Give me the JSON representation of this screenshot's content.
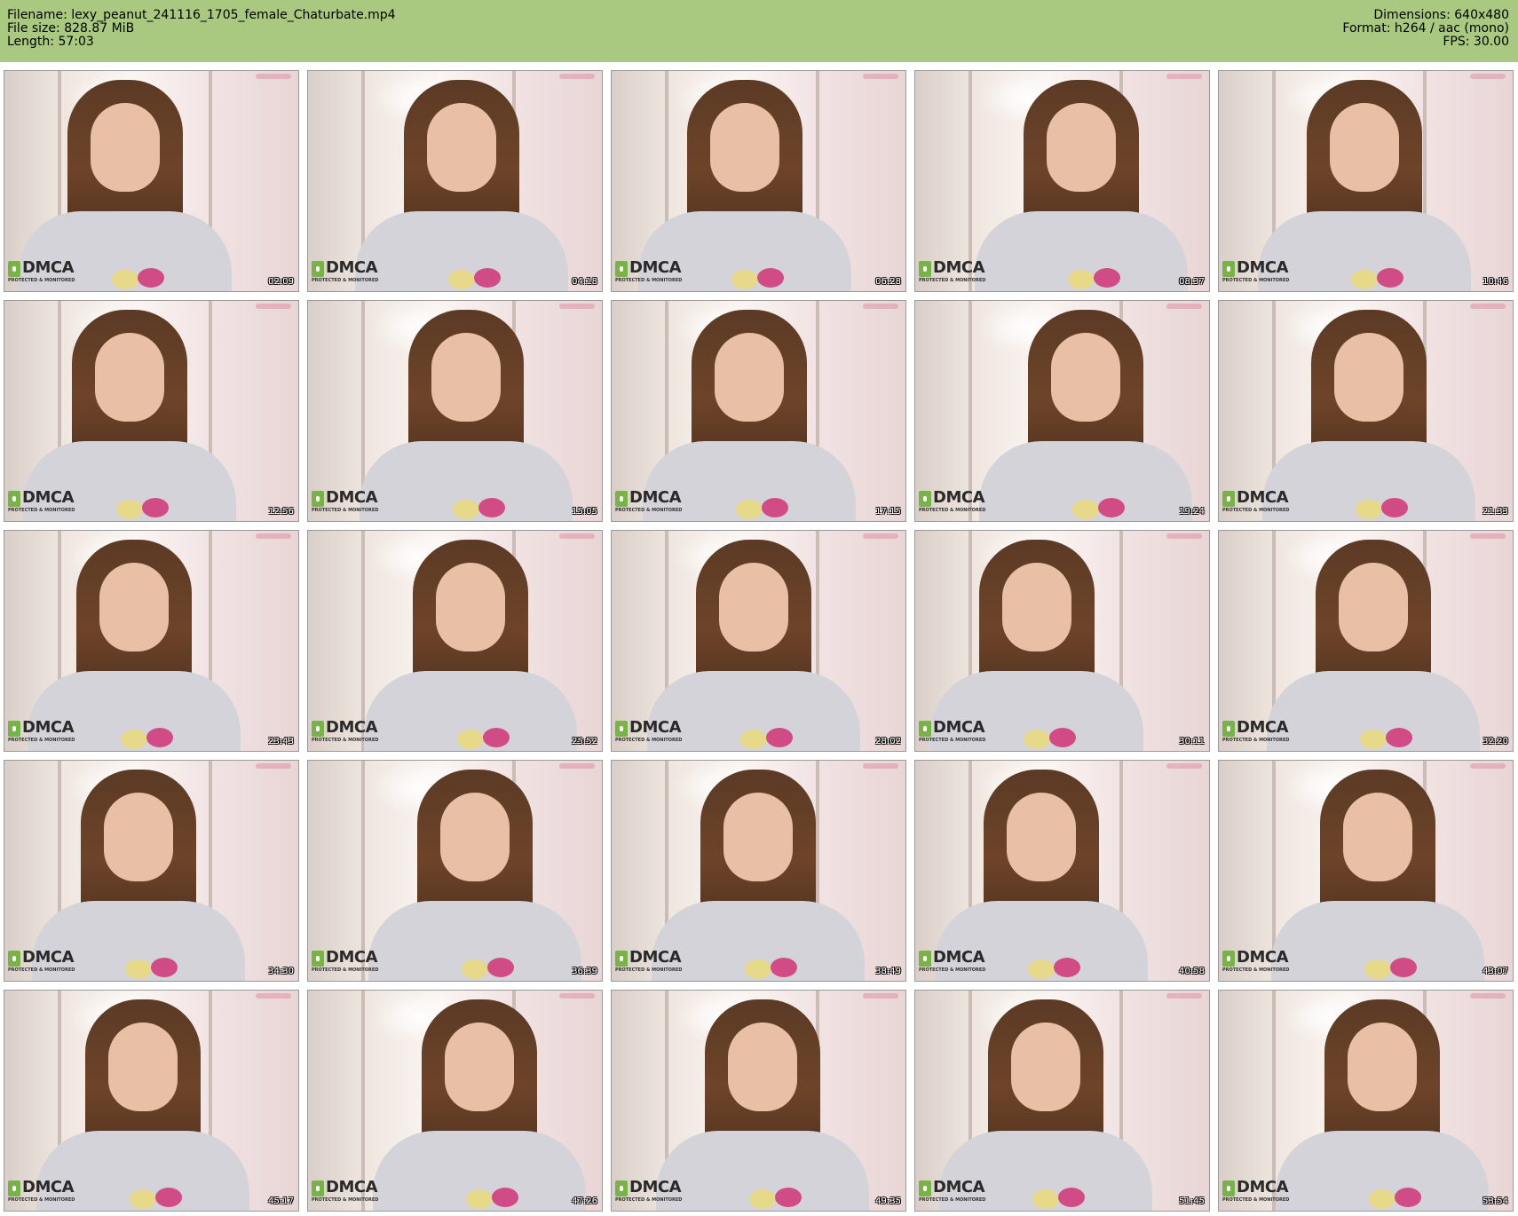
{
  "header": {
    "filename_label": "Filename: lexy_peanut_241116_1705_female_Chaturbate.mp4",
    "filesize_label": "File size: 828.87 MiB",
    "length_label": "Length: 57:03",
    "dimensions_label": "Dimensions: 640x480",
    "format_label": "Format: h264 / aac (mono)",
    "fps_label": "FPS: 30.00"
  },
  "watermark": {
    "logo": "DMCA",
    "tagline": "PROTECTED & MONITORED"
  },
  "thumbnails": [
    {
      "timestamp": "02:09"
    },
    {
      "timestamp": "04:18"
    },
    {
      "timestamp": "06:28"
    },
    {
      "timestamp": "08:37"
    },
    {
      "timestamp": "10:46"
    },
    {
      "timestamp": "12:56"
    },
    {
      "timestamp": "15:05"
    },
    {
      "timestamp": "17:15"
    },
    {
      "timestamp": "19:24"
    },
    {
      "timestamp": "21:33"
    },
    {
      "timestamp": "23:43"
    },
    {
      "timestamp": "25:52"
    },
    {
      "timestamp": "28:02"
    },
    {
      "timestamp": "30:11"
    },
    {
      "timestamp": "32:20"
    },
    {
      "timestamp": "34:30"
    },
    {
      "timestamp": "36:39"
    },
    {
      "timestamp": "38:49"
    },
    {
      "timestamp": "40:58"
    },
    {
      "timestamp": "43:07"
    },
    {
      "timestamp": "45:17"
    },
    {
      "timestamp": "47:26"
    },
    {
      "timestamp": "49:35"
    },
    {
      "timestamp": "51:45"
    },
    {
      "timestamp": "53:54"
    }
  ],
  "colors": {
    "header_bg": "#a8c97f",
    "border": "#9a9a9a",
    "dmca_green": "#7ab24a"
  }
}
